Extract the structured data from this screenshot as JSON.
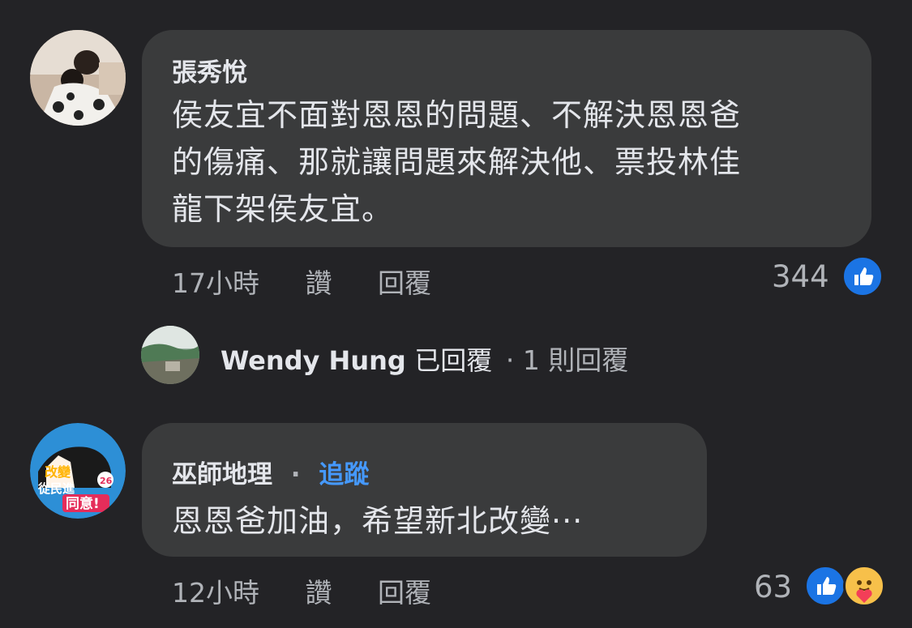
{
  "comments": [
    {
      "author": "張秀悅",
      "text_lines": [
        "侯友宜不面對恩恩的問題、不解決恩恩爸",
        "的傷痛、那就讓問題來解決他、票投林佳",
        "龍下架侯友宜。"
      ],
      "time": "17小時",
      "like_label": "讚",
      "reply_label": "回覆",
      "reaction_count": "344",
      "reactions": [
        "like-icon"
      ]
    },
    {
      "author": "巫師地理",
      "follow_separator": "·",
      "follow_label": "追蹤",
      "text": "恩恩爸加油，希望新北改變···",
      "time": "12小時",
      "like_label": "讚",
      "reply_label": "回覆",
      "reaction_count": "63",
      "reactions": [
        "like-icon",
        "care-icon"
      ],
      "avatar_text": [
        "改變",
        "從民進",
        "同意!",
        "26"
      ]
    }
  ],
  "reply_summary": {
    "name": "Wendy Hung",
    "action": "已回覆",
    "separator": "·",
    "count_text": "1 則回覆"
  },
  "colors": {
    "background": "#232326",
    "bubble": "#3a3b3c",
    "accent": "#4599ff",
    "like": "#1b74e4"
  }
}
